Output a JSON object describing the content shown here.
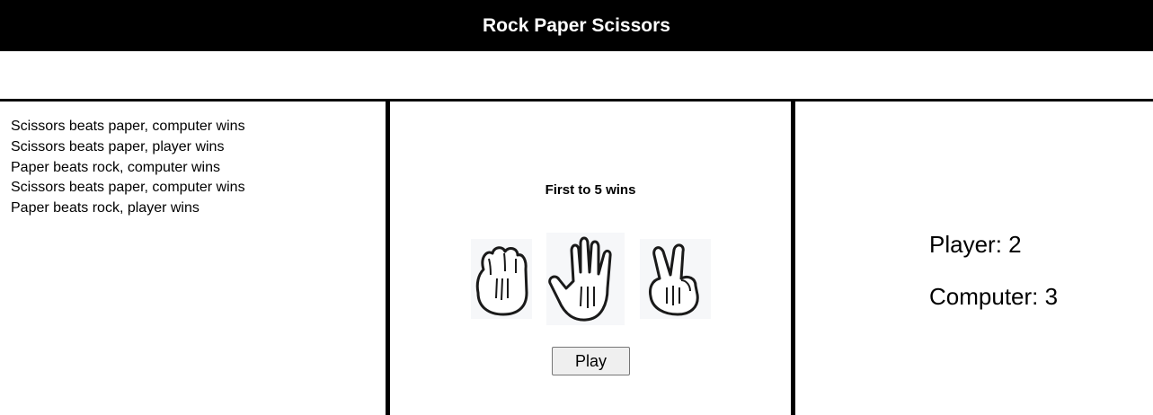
{
  "header": {
    "title": "Rock Paper Scissors"
  },
  "log": {
    "entries": [
      "Scissors beats paper, computer wins",
      "Scissors beats paper, player wins",
      "Paper beats rock, computer wins",
      "Scissors beats paper, computer wins",
      "Paper beats rock, player wins"
    ]
  },
  "game": {
    "rule": "First to 5 wins",
    "choices": [
      {
        "id": "rock",
        "icon": "rock-hand-icon"
      },
      {
        "id": "paper",
        "icon": "paper-hand-icon"
      },
      {
        "id": "scissors",
        "icon": "scissors-hand-icon"
      }
    ],
    "play_label": "Play"
  },
  "scoreboard": {
    "player": "Player: 2",
    "computer": "Computer: 3"
  }
}
